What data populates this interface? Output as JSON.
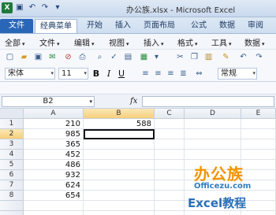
{
  "window": {
    "title": "办公族.xlsx - Microsoft Excel"
  },
  "qat": {
    "logo": "X"
  },
  "ribbon_tabs": [
    {
      "label": "文件"
    },
    {
      "label": "经典菜单"
    },
    {
      "label": "开始"
    },
    {
      "label": "插入"
    },
    {
      "label": "页面布局"
    },
    {
      "label": "公式"
    },
    {
      "label": "数据"
    },
    {
      "label": "审阅"
    }
  ],
  "menus": [
    {
      "label": "全部"
    },
    {
      "label": "文件"
    },
    {
      "label": "编辑"
    },
    {
      "label": "视图"
    },
    {
      "label": "插入"
    },
    {
      "label": "格式"
    },
    {
      "label": "工具"
    },
    {
      "label": "数据"
    }
  ],
  "format": {
    "font": "宋体",
    "size": "11",
    "bold": "B",
    "italic": "I",
    "underline": "U",
    "number_format": "常规"
  },
  "formula_bar": {
    "name_box": "B2",
    "fx_label": "fx",
    "formula": ""
  },
  "grid": {
    "columns": [
      "A",
      "B",
      "C",
      "D",
      "E"
    ],
    "selected_column": "B",
    "selected_row": 2,
    "active_cell": "B2",
    "rows": [
      {
        "num": "1",
        "A": "210",
        "B": "588"
      },
      {
        "num": "2",
        "A": "985",
        "B": ""
      },
      {
        "num": "3",
        "A": "365",
        "B": ""
      },
      {
        "num": "4",
        "A": "452",
        "B": ""
      },
      {
        "num": "5",
        "A": "486",
        "B": ""
      },
      {
        "num": "6",
        "A": "932",
        "B": ""
      },
      {
        "num": "7",
        "A": "624",
        "B": ""
      },
      {
        "num": "8",
        "A": "654",
        "B": ""
      }
    ]
  },
  "watermark": {
    "brand": "办公族",
    "site": "Officezu.com",
    "tagline": "Excel教程"
  }
}
